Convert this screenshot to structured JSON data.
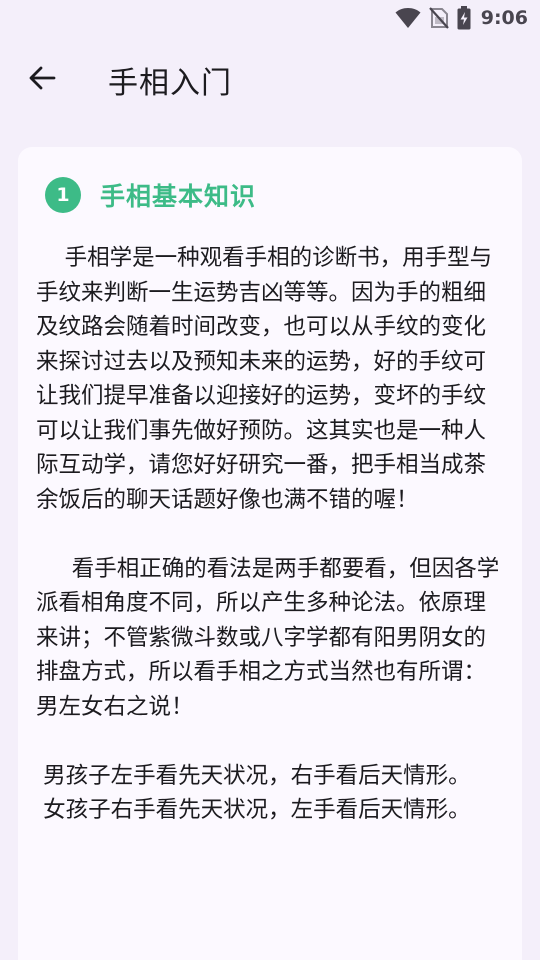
{
  "status_bar": {
    "time": "9:06",
    "icons": [
      "wifi-icon",
      "no-sim-icon",
      "battery-charging-icon"
    ]
  },
  "app_bar": {
    "back_icon": "arrow-back-icon",
    "title": "手相入门"
  },
  "section": {
    "number": "1",
    "title": "手相基本知识",
    "body": "    手相学是一种观看手相的诊断书，用手型与手纹来判断一生运势吉凶等等。因为手的粗细及纹路会随着时间改变，也可以从手纹的变化来探讨过去以及预知未来的运势，好的手纹可让我们提早准备以迎接好的运势，变坏的手纹可以让我们事先做好预防。这其实也是一种人际互动学，请您好好研究一番，把手相当成茶余饭后的聊天话题好像也满不错的喔！\n\n     看手相正确的看法是两手都要看，但因各学派看相角度不同，所以产生多种论法。依原理来讲；不管紫微斗数或八字学都有阳男阴女的排盘方式，所以看手相之方式当然也有所谓：男左女右之说！\n\n 男孩子左手看先天状况，右手看后天情形。\n 女孩子右手看先天状况，左手看后天情形。"
  },
  "colors": {
    "background": "#f4effa",
    "card": "#fcf9ff",
    "accent": "#3dbb87",
    "text": "#1c1b1f"
  }
}
